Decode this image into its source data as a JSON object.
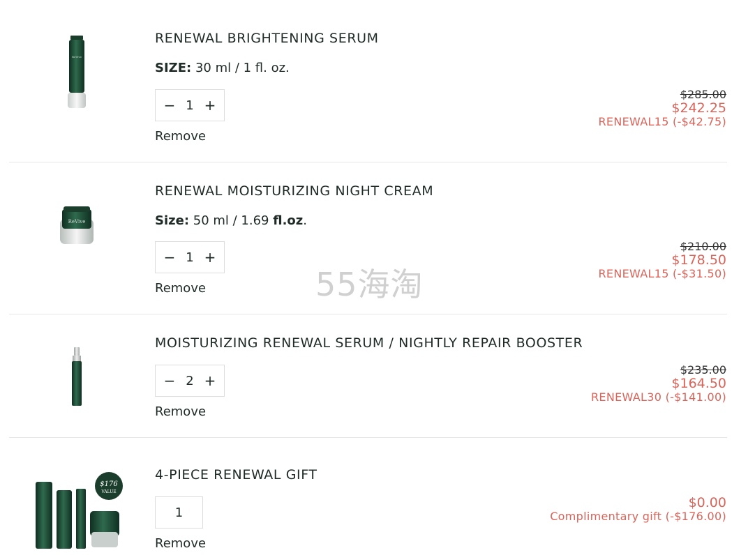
{
  "items": [
    {
      "title": "RENEWAL BRIGHTENING SERUM",
      "size_label": "SIZE:",
      "size_value": " 30 ml / 1 fl. oz.",
      "quantity": "1",
      "remove": "Remove",
      "original_price": "$285.00",
      "sale_price": "$242.25",
      "discount": "RENEWAL15 (-$42.75)",
      "thumbnail": "serum-bottle-image"
    },
    {
      "title": "RENEWAL MOISTURIZING NIGHT CREAM",
      "size_label": "Size:",
      "size_value": " 50 ml / 1.69 ",
      "size_value_bold": "fl.oz",
      "size_value_end": ".",
      "quantity": "1",
      "remove": "Remove",
      "original_price": "$210.00",
      "sale_price": "$178.50",
      "discount": "RENEWAL15 (-$31.50)",
      "thumbnail": "cream-jar-image"
    },
    {
      "title": "MOISTURIZING RENEWAL SERUM / NIGHTLY REPAIR BOOSTER",
      "quantity": "2",
      "remove": "Remove",
      "original_price": "$235.00",
      "sale_price": "$164.50",
      "discount": "RENEWAL30 (-$141.00)",
      "thumbnail": "booster-pump-image"
    },
    {
      "title": "4-PIECE RENEWAL GIFT",
      "quantity": "1",
      "remove": "Remove",
      "sale_price": "$0.00",
      "discount": "Complimentary gift (-$176.00)",
      "badge_amount": "$176",
      "badge_label": "VALUE",
      "thumbnail": "gift-set-image"
    }
  ],
  "controls": {
    "minus": "−",
    "plus": "+"
  },
  "watermark": "55海淘",
  "colors": {
    "accent": "#d9645a",
    "text": "#1f2b26",
    "bottle": "#1e4a35"
  }
}
